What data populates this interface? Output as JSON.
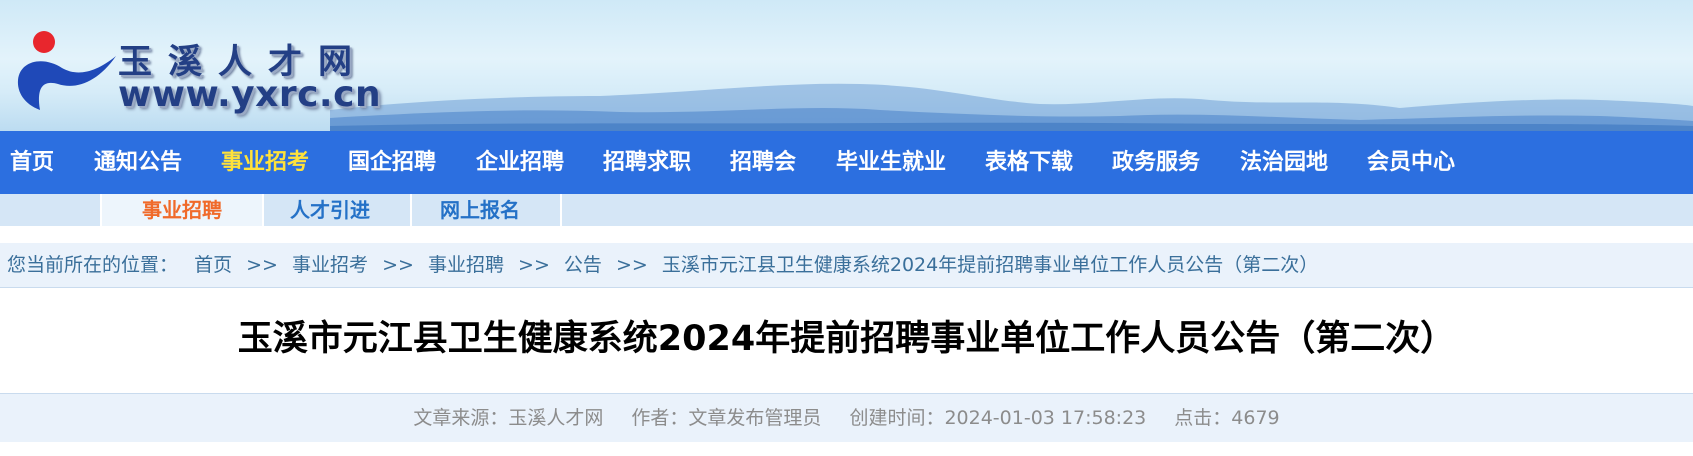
{
  "site": {
    "title": "玉溪人才网",
    "url": "www.yxrc.cn"
  },
  "nav": {
    "items": [
      {
        "label": "首页"
      },
      {
        "label": "通知公告"
      },
      {
        "label": "事业招考",
        "active": true
      },
      {
        "label": "国企招聘"
      },
      {
        "label": "企业招聘"
      },
      {
        "label": "招聘求职"
      },
      {
        "label": "招聘会"
      },
      {
        "label": "毕业生就业"
      },
      {
        "label": "表格下载"
      },
      {
        "label": "政务服务"
      },
      {
        "label": "法治园地"
      },
      {
        "label": "会员中心"
      }
    ],
    "active_color": "#ffe23a",
    "bar_color": "#2c6fe0"
  },
  "subnav": {
    "items": [
      {
        "label": "事业招聘",
        "active": true
      },
      {
        "label": "人才引进"
      },
      {
        "label": "网上报名"
      }
    ],
    "active_color": "#f06a2a"
  },
  "breadcrumb": {
    "prefix": "您当前所在的位置：",
    "items": [
      "首页",
      "事业招考",
      "事业招聘",
      "公告",
      "玉溪市元江县卫生健康系统2024年提前招聘事业单位工作人员公告（第二次）"
    ],
    "separator": ">>"
  },
  "article": {
    "title": "玉溪市元江县卫生健康系统2024年提前招聘事业单位工作人员公告（第二次）",
    "source": "文章来源：玉溪人才网",
    "author": "作者：文章发布管理员",
    "created": "创建时间：2024-01-03 17:58:23",
    "clicks": "点击：4679"
  }
}
